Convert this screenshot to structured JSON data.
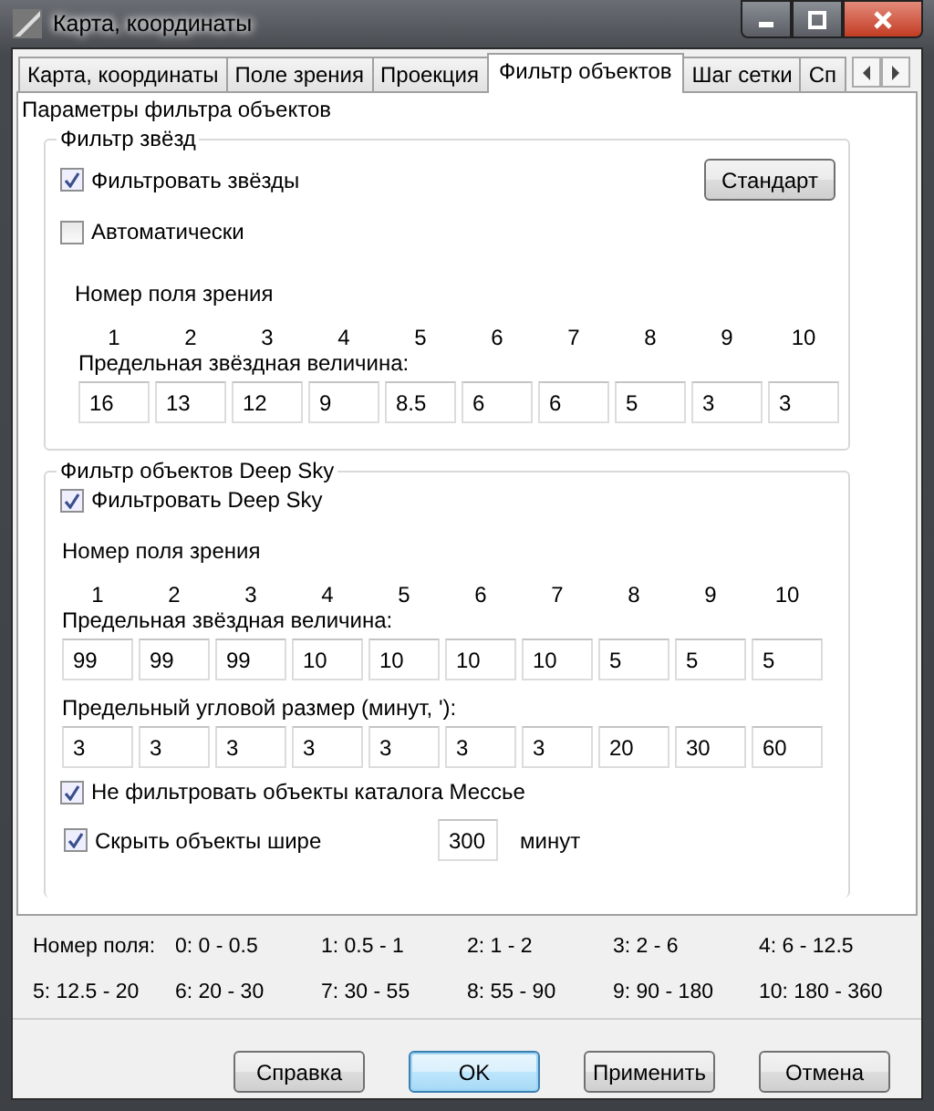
{
  "window": {
    "title": "Карта, координаты"
  },
  "tabs": [
    {
      "label": "Карта, координаты",
      "selected": false
    },
    {
      "label": "Поле зрения",
      "selected": false
    },
    {
      "label": "Проекция",
      "selected": false
    },
    {
      "label": "Фильтр объектов",
      "selected": true
    },
    {
      "label": "Шаг сетки",
      "selected": false
    },
    {
      "label": "Сп",
      "selected": false
    }
  ],
  "panel_title": "Параметры фильтра объектов",
  "star_filter": {
    "title": "Фильтр звёзд",
    "filter_checkbox": {
      "label": "Фильтровать звёзды",
      "checked": true
    },
    "standard_button": "Стандарт",
    "auto_checkbox": {
      "label": "Автоматически",
      "checked": false
    },
    "field_number_label": "Номер поля зрения",
    "field_numbers": [
      "1",
      "2",
      "3",
      "4",
      "5",
      "6",
      "7",
      "8",
      "9",
      "10"
    ],
    "magnitude_label": "Предельная звёздная величина:",
    "magnitudes": [
      "16",
      "13",
      "12",
      "9",
      "8.5",
      "6",
      "6",
      "5",
      "3",
      "3"
    ]
  },
  "deep_sky": {
    "title": "Фильтр объектов Deep Sky",
    "filter_checkbox": {
      "label": "Фильтровать Deep Sky",
      "checked": true
    },
    "field_number_label": "Номер поля зрения",
    "field_numbers": [
      "1",
      "2",
      "3",
      "4",
      "5",
      "6",
      "7",
      "8",
      "9",
      "10"
    ],
    "magnitude_label": "Предельная звёздная величина:",
    "magnitudes": [
      "99",
      "99",
      "99",
      "10",
      "10",
      "10",
      "10",
      "5",
      "5",
      "5"
    ],
    "size_label": "Предельный угловой размер (минут, '):",
    "sizes": [
      "3",
      "3",
      "3",
      "3",
      "3",
      "3",
      "3",
      "20",
      "30",
      "60"
    ],
    "messier_checkbox": {
      "label": "Не фильтровать объекты каталога Мессье",
      "checked": true
    },
    "hide_checkbox": {
      "label": "Скрыть объекты шире",
      "checked": true,
      "value": "300",
      "unit": "минут"
    }
  },
  "legend": {
    "label": "Номер поля:",
    "items": [
      "0: 0 - 0.5",
      "1: 0.5 - 1",
      "2: 1 - 2",
      "3: 2 - 6",
      "4: 6 - 12.5",
      "5: 12.5 - 20",
      "6: 20 - 30",
      "7: 30 - 55",
      "8: 55 - 90",
      "9: 90 - 180",
      "10: 180 - 360"
    ]
  },
  "buttons": [
    {
      "label": "Справка",
      "default": false
    },
    {
      "label": "OK",
      "default": true
    },
    {
      "label": "Применить",
      "default": false
    },
    {
      "label": "Отмена",
      "default": false
    }
  ]
}
